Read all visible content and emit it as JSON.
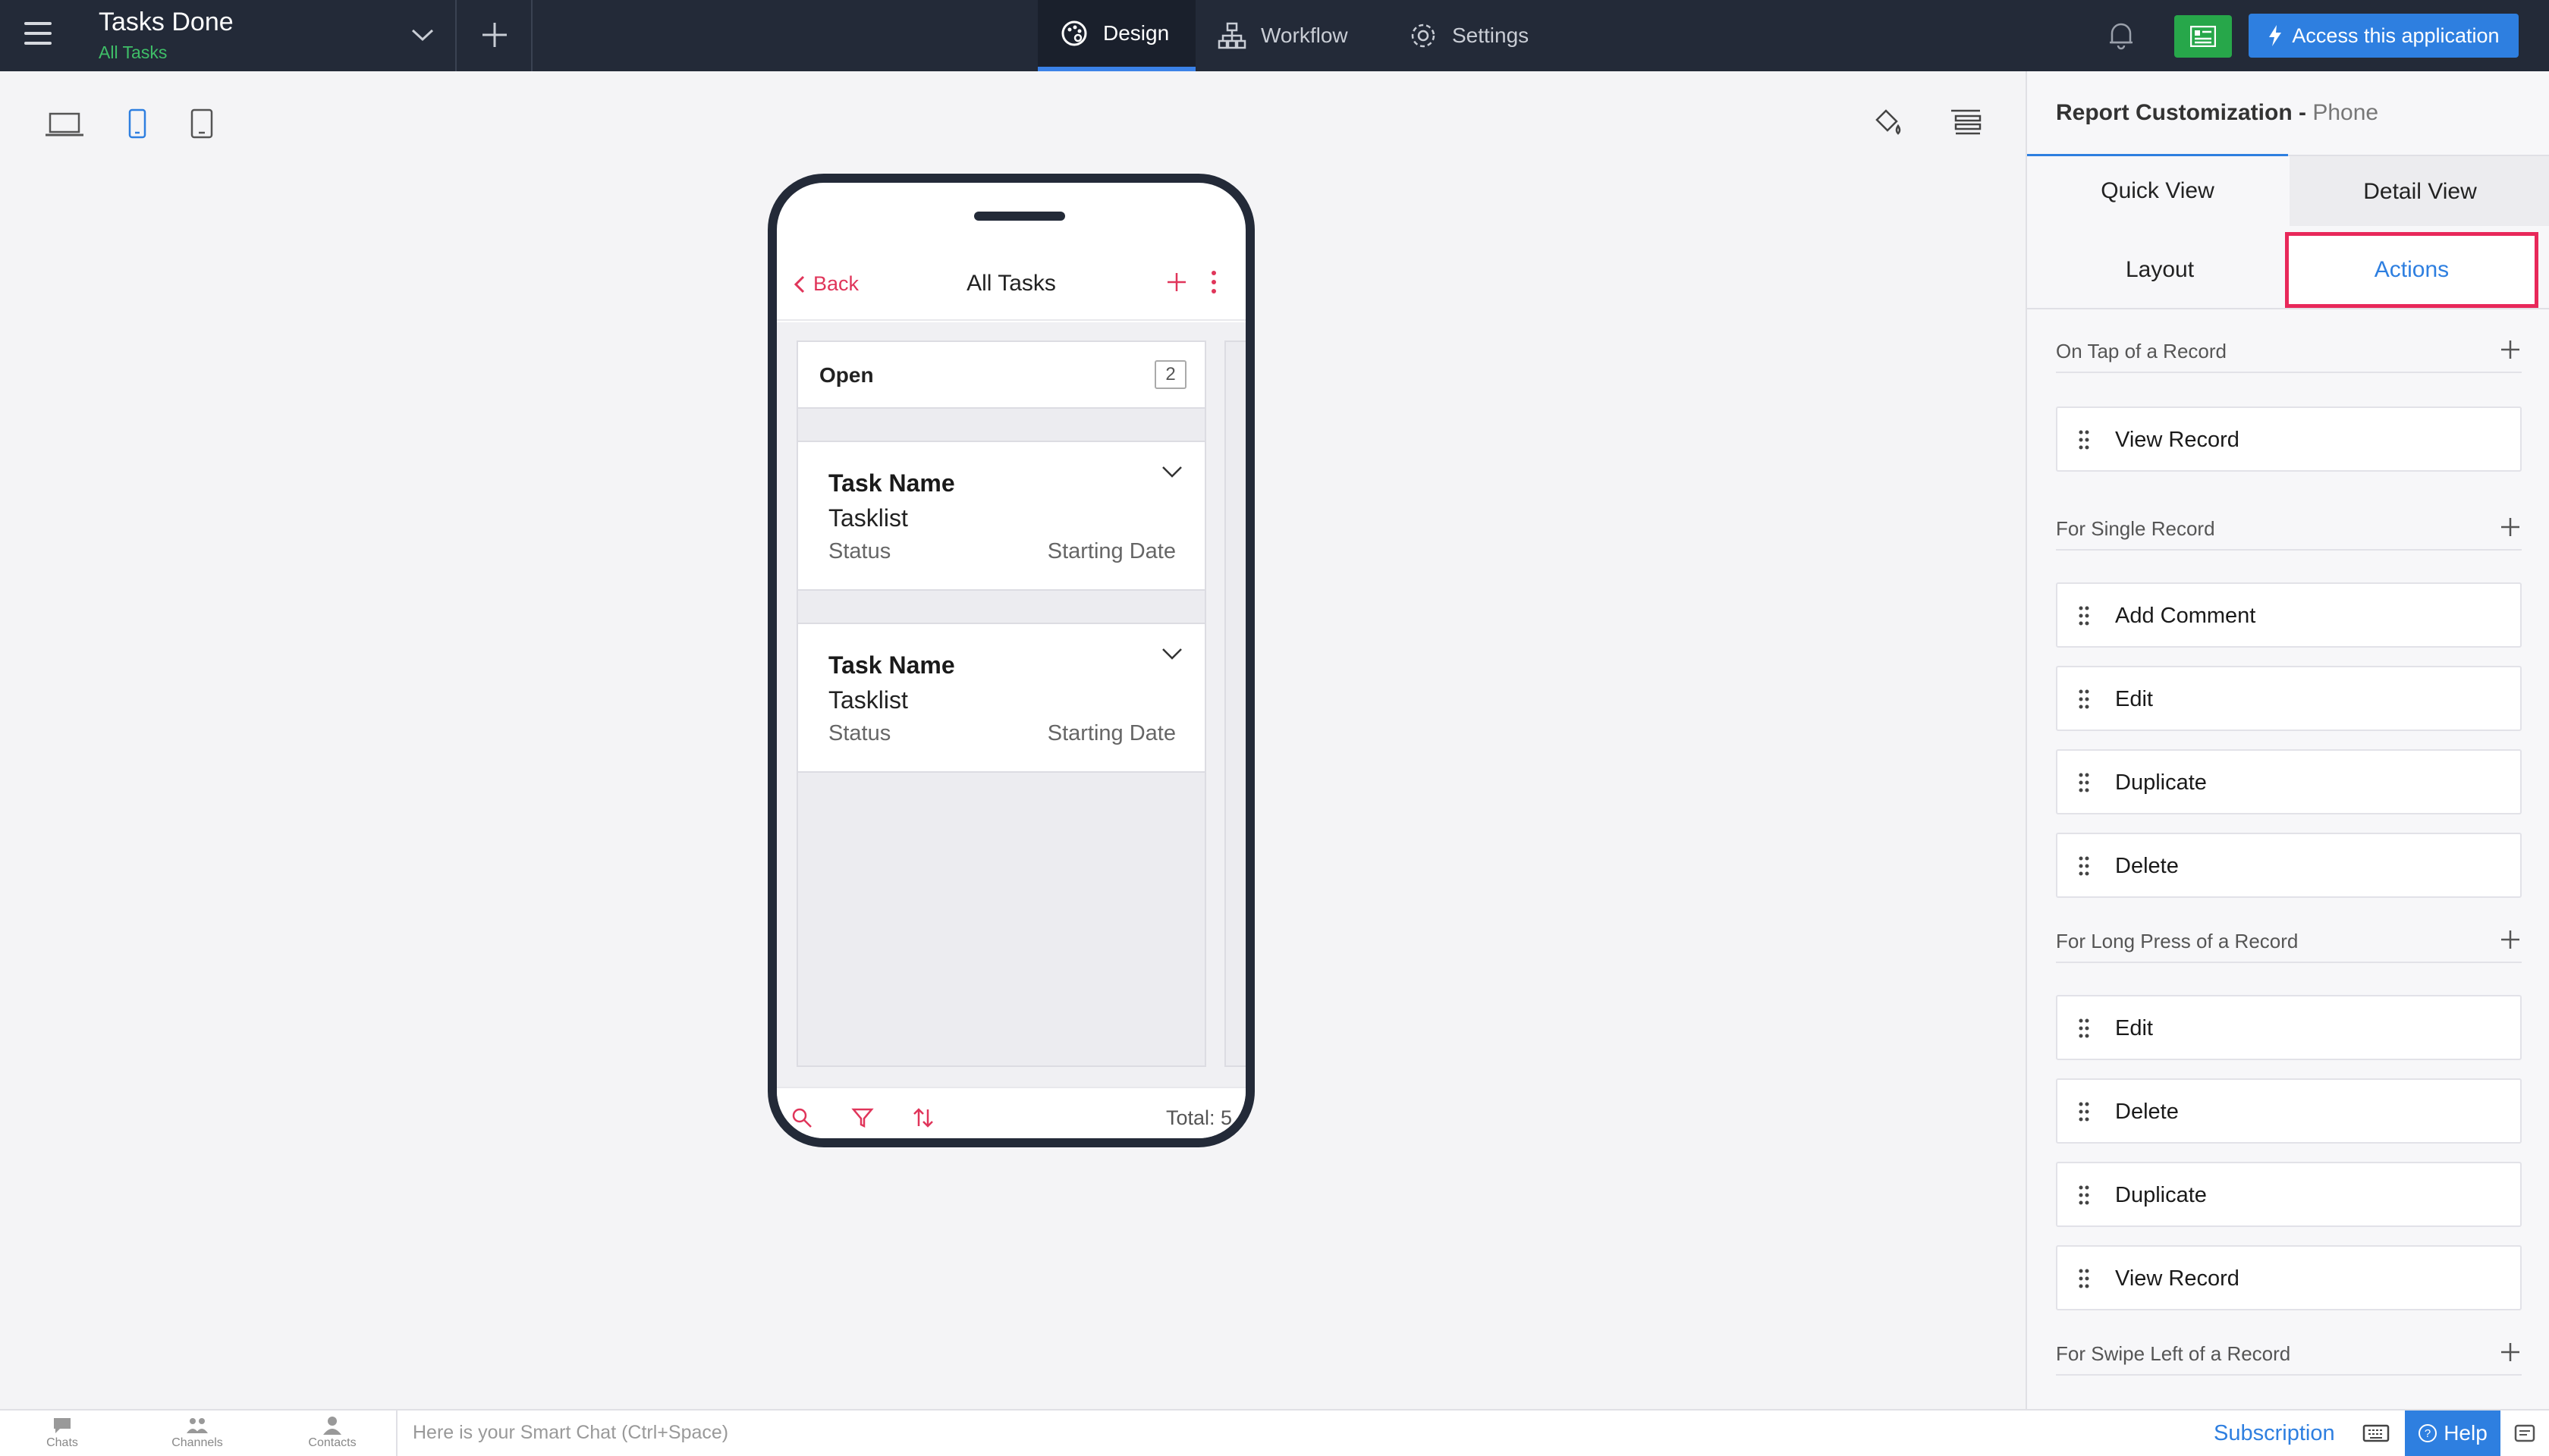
{
  "header": {
    "app_title": "Tasks Done",
    "app_subtitle": "All Tasks",
    "nav": [
      {
        "label": "Design",
        "icon": "palette-icon"
      },
      {
        "label": "Workflow",
        "icon": "workflow-icon"
      },
      {
        "label": "Settings",
        "icon": "gear-icon"
      }
    ],
    "access_label": "Access this application"
  },
  "colors": {
    "topbar": "#232a38",
    "accent": "#2e7fe0",
    "phone_accent": "#e0355a",
    "highlight": "#e8285a",
    "green": "#27a74a"
  },
  "phone": {
    "back_label": "Back",
    "title": "All Tasks",
    "column": {
      "label": "Open",
      "count": "2"
    },
    "cards": [
      {
        "name": "Task Name",
        "list": "Tasklist",
        "status": "Status",
        "date": "Starting Date"
      },
      {
        "name": "Task Name",
        "list": "Tasklist",
        "status": "Status",
        "date": "Starting Date"
      }
    ],
    "total": "Total: 5"
  },
  "panel": {
    "title": "Report Customization -",
    "title_device": "Phone",
    "view_tabs": [
      "Quick View",
      "Detail View"
    ],
    "sub_tabs": [
      "Layout",
      "Actions"
    ],
    "sections": [
      {
        "label": "On Tap of a Record",
        "items": [
          "View Record"
        ]
      },
      {
        "label": "For Single Record",
        "items": [
          "Add Comment",
          "Edit",
          "Duplicate",
          "Delete"
        ]
      },
      {
        "label": "For Long Press of a Record",
        "items": [
          "Edit",
          "Delete",
          "Duplicate",
          "View Record"
        ]
      },
      {
        "label": "For Swipe Left of a Record",
        "items": []
      }
    ]
  },
  "footer": {
    "chats": "Chats",
    "channels": "Channels",
    "contacts": "Contacts",
    "chat_placeholder": "Here is your Smart Chat (Ctrl+Space)",
    "subscription": "Subscription",
    "help": "Help"
  }
}
